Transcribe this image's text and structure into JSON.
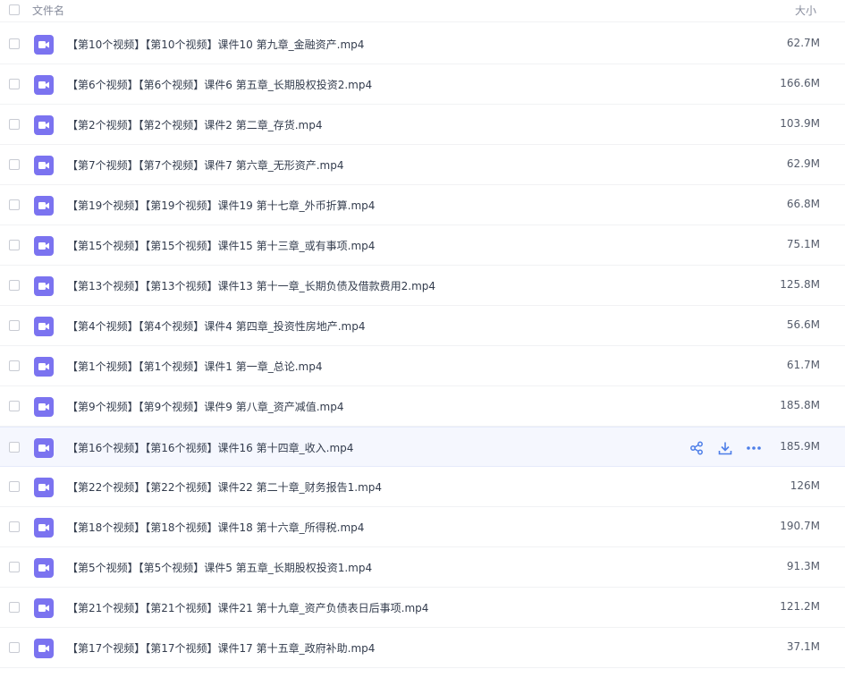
{
  "header": {
    "name_label": "文件名",
    "size_label": "大小"
  },
  "files": [
    {
      "name": "【第10个视频】【第10个视频】课件10 第九章_金融资产.mp4",
      "size": "62.7M"
    },
    {
      "name": "【第6个视频】【第6个视频】课件6 第五章_长期股权投资2.mp4",
      "size": "166.6M"
    },
    {
      "name": "【第2个视频】【第2个视频】课件2 第二章_存货.mp4",
      "size": "103.9M"
    },
    {
      "name": "【第7个视频】【第7个视频】课件7 第六章_无形资产.mp4",
      "size": "62.9M"
    },
    {
      "name": "【第19个视频】【第19个视频】课件19 第十七章_外币折算.mp4",
      "size": "66.8M"
    },
    {
      "name": "【第15个视频】【第15个视频】课件15 第十三章_或有事项.mp4",
      "size": "75.1M"
    },
    {
      "name": "【第13个视频】【第13个视频】课件13 第十一章_长期负债及借款费用2.mp4",
      "size": "125.8M"
    },
    {
      "name": "【第4个视频】【第4个视频】课件4 第四章_投资性房地产.mp4",
      "size": "56.6M"
    },
    {
      "name": "【第1个视频】【第1个视频】课件1 第一章_总论.mp4",
      "size": "61.7M"
    },
    {
      "name": "【第9个视频】【第9个视频】课件9 第八章_资产减值.mp4",
      "size": "185.8M"
    },
    {
      "name": "【第16个视频】【第16个视频】课件16 第十四章_收入.mp4",
      "size": "185.9M"
    },
    {
      "name": "【第22个视频】【第22个视频】课件22 第二十章_财务报告1.mp4",
      "size": "126M"
    },
    {
      "name": "【第18个视频】【第18个视频】课件18 第十六章_所得税.mp4",
      "size": "190.7M"
    },
    {
      "name": "【第5个视频】【第5个视频】课件5 第五章_长期股权投资1.mp4",
      "size": "91.3M"
    },
    {
      "name": "【第21个视频】【第21个视频】课件21 第十九章_资产负债表日后事项.mp4",
      "size": "121.2M"
    },
    {
      "name": "【第17个视频】【第17个视频】课件17 第十五章_政府补助.mp4",
      "size": "37.1M"
    }
  ],
  "hover_row_index": 10,
  "icons": {
    "file": "video-file-icon",
    "share": "share-icon",
    "download": "download-icon",
    "more": "more-icon"
  },
  "colors": {
    "accent": "#4d7ee8",
    "file_icon": "#7b73f0",
    "hover_bg": "#f5f7fe"
  }
}
